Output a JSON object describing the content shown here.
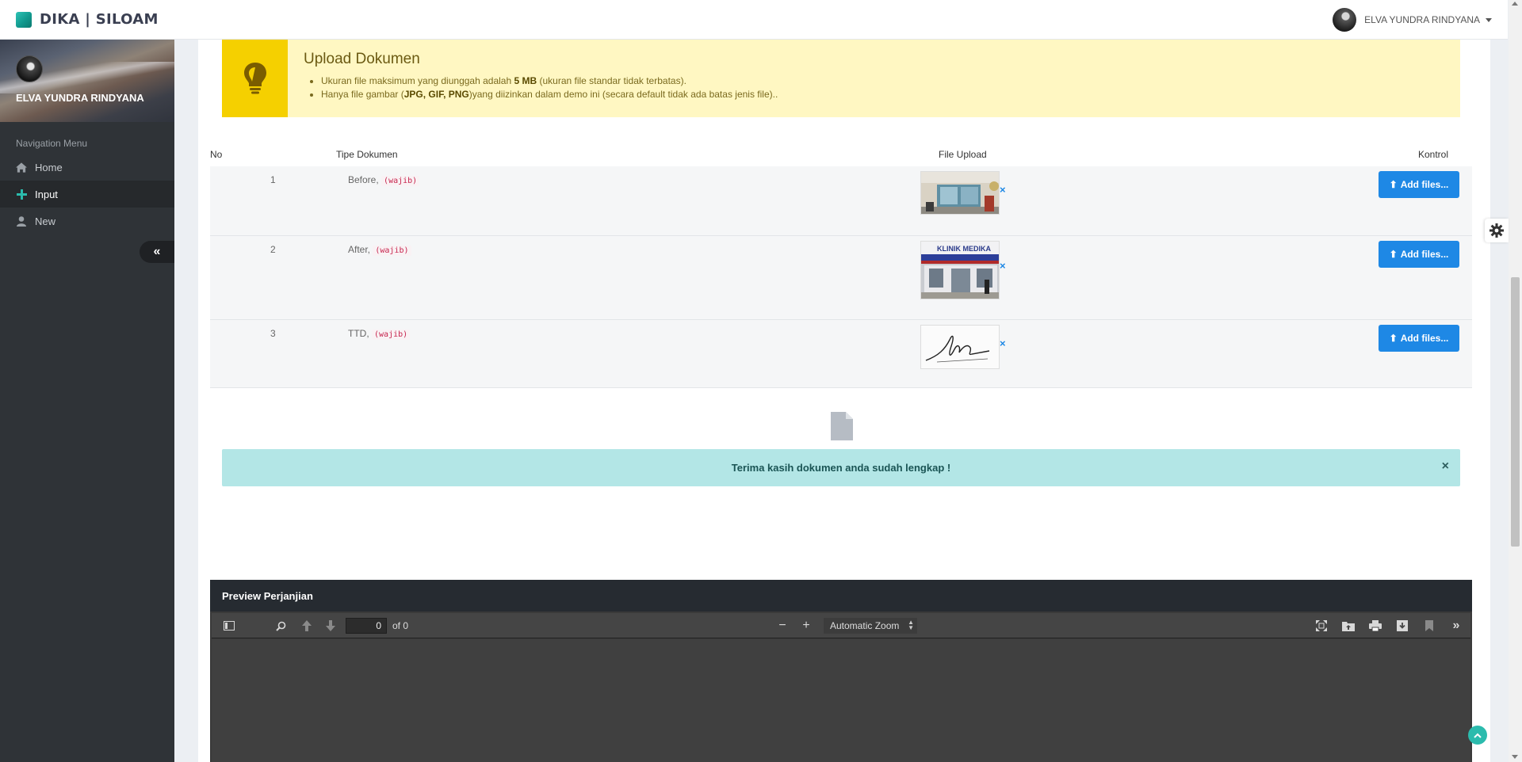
{
  "app": {
    "brand": "DIKA | SILOAM",
    "accent": "#2bbbad"
  },
  "header": {
    "user_name": "ELVA YUNDRA RINDYANA"
  },
  "sidebar": {
    "profile_name": "ELVA YUNDRA RINDYANA",
    "heading": "Navigation Menu",
    "items": [
      {
        "label": "Home",
        "icon": "home-icon",
        "active": false
      },
      {
        "label": "Input",
        "icon": "plus-icon",
        "active": true
      },
      {
        "label": "New",
        "icon": "user-icon",
        "active": false
      }
    ],
    "collapse_icon": "double-chevron-left-icon"
  },
  "callout": {
    "title": "Upload Dokumen",
    "icon": "lightbulb-icon",
    "line1_prefix": "Ukuran file maksimum yang diunggah adalah ",
    "line1_bold": "5 MB",
    "line1_suffix": " (ukuran file standar tidak terbatas).",
    "line2_prefix": "Hanya file gambar (",
    "line2_bold": "JPG, GIF, PNG",
    "line2_suffix": ")yang diizinkan dalam demo ini (secara default tidak ada batas jenis file).."
  },
  "table": {
    "headers": {
      "no": "No",
      "type": "Tipe Dokumen",
      "file": "File Upload",
      "control": "Kontrol"
    },
    "rows": [
      {
        "no": "1",
        "type": "Before,",
        "tag": "(wajib)",
        "button": "Add files...",
        "thumb": "clinic-front-photo"
      },
      {
        "no": "2",
        "type": "After,",
        "tag": "(wajib)",
        "button": "Add files...",
        "thumb": "klinik-medika-photo"
      },
      {
        "no": "3",
        "type": "TTD,",
        "tag": "(wajib)",
        "button": "Add files...",
        "thumb": "signature-image"
      }
    ],
    "thumb_sign_text": "KLINIK MEDIKA"
  },
  "alert": {
    "message": "Terima kasih dokumen anda sudah lengkap !",
    "close": "×"
  },
  "preview": {
    "title": "Preview Perjanjian",
    "page_value": "0",
    "page_of": "of 0",
    "zoom": "Automatic Zoom"
  }
}
